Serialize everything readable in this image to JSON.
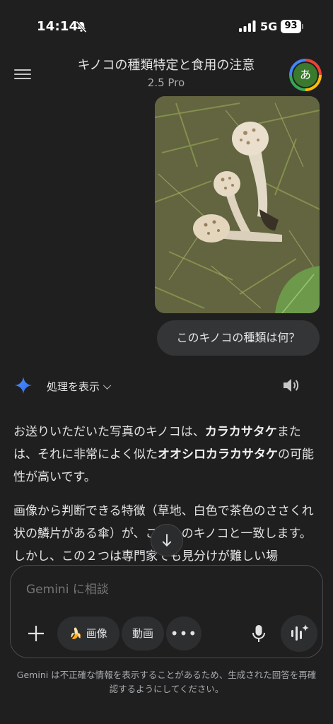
{
  "status_bar": {
    "time": "14:14",
    "network": "5G",
    "battery": "93"
  },
  "header": {
    "title": "キノコの種類特定と食用の注意",
    "model": "2.5 Pro",
    "avatar_letter": "あ"
  },
  "user_message": {
    "text": "このキノコの種類は何？"
  },
  "response": {
    "show_thinking_label": "処理を表示",
    "p1": [
      "お送りいただいた写真のキノコは、",
      "カラカサタケ",
      "または、それに非常によく似た",
      "オオシロカラカサタケ",
      "の可能性が高いです。"
    ],
    "p2": "画像から判断できる特徴（草地、白色で茶色のささくれ状の鱗片がある傘）が、これらのキノコと一致します。しかし、この２つは専門家でも見分けが難しい場"
  },
  "composer": {
    "placeholder": "Gemini に相談",
    "image_chip": "画像",
    "video_chip": "動画"
  },
  "disclaimer": "Gemini は不正確な情報を表示することがあるため、生成された回答を再確認するようにしてください。",
  "colors": {
    "background": "#1f1f20",
    "bubble": "#333537",
    "accent": "#4285f4"
  },
  "icons": [
    "menu-icon",
    "gemini-spark-icon",
    "speaker-icon",
    "chevron-down-icon",
    "arrow-down-icon",
    "plus-icon",
    "banana-icon",
    "more-icon",
    "mic-icon",
    "live-icon"
  ]
}
